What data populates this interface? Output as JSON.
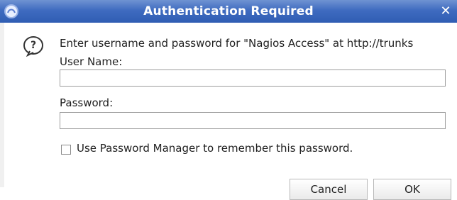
{
  "window": {
    "title": "Authentication Required"
  },
  "message": "Enter username and password for \"Nagios Access\" at http://trunks",
  "form": {
    "username_label": "User Name:",
    "username_value": "",
    "password_label": "Password:",
    "password_value": "",
    "remember_label": "Use Password Manager to remember this password.",
    "remember_checked": false
  },
  "buttons": {
    "cancel": "Cancel",
    "ok": "OK"
  },
  "icons": {
    "app": "app-icon",
    "close": "close-icon",
    "question": "question-icon"
  },
  "colors": {
    "titlebar": "#3f6bc0",
    "title_text": "#ffffff"
  }
}
